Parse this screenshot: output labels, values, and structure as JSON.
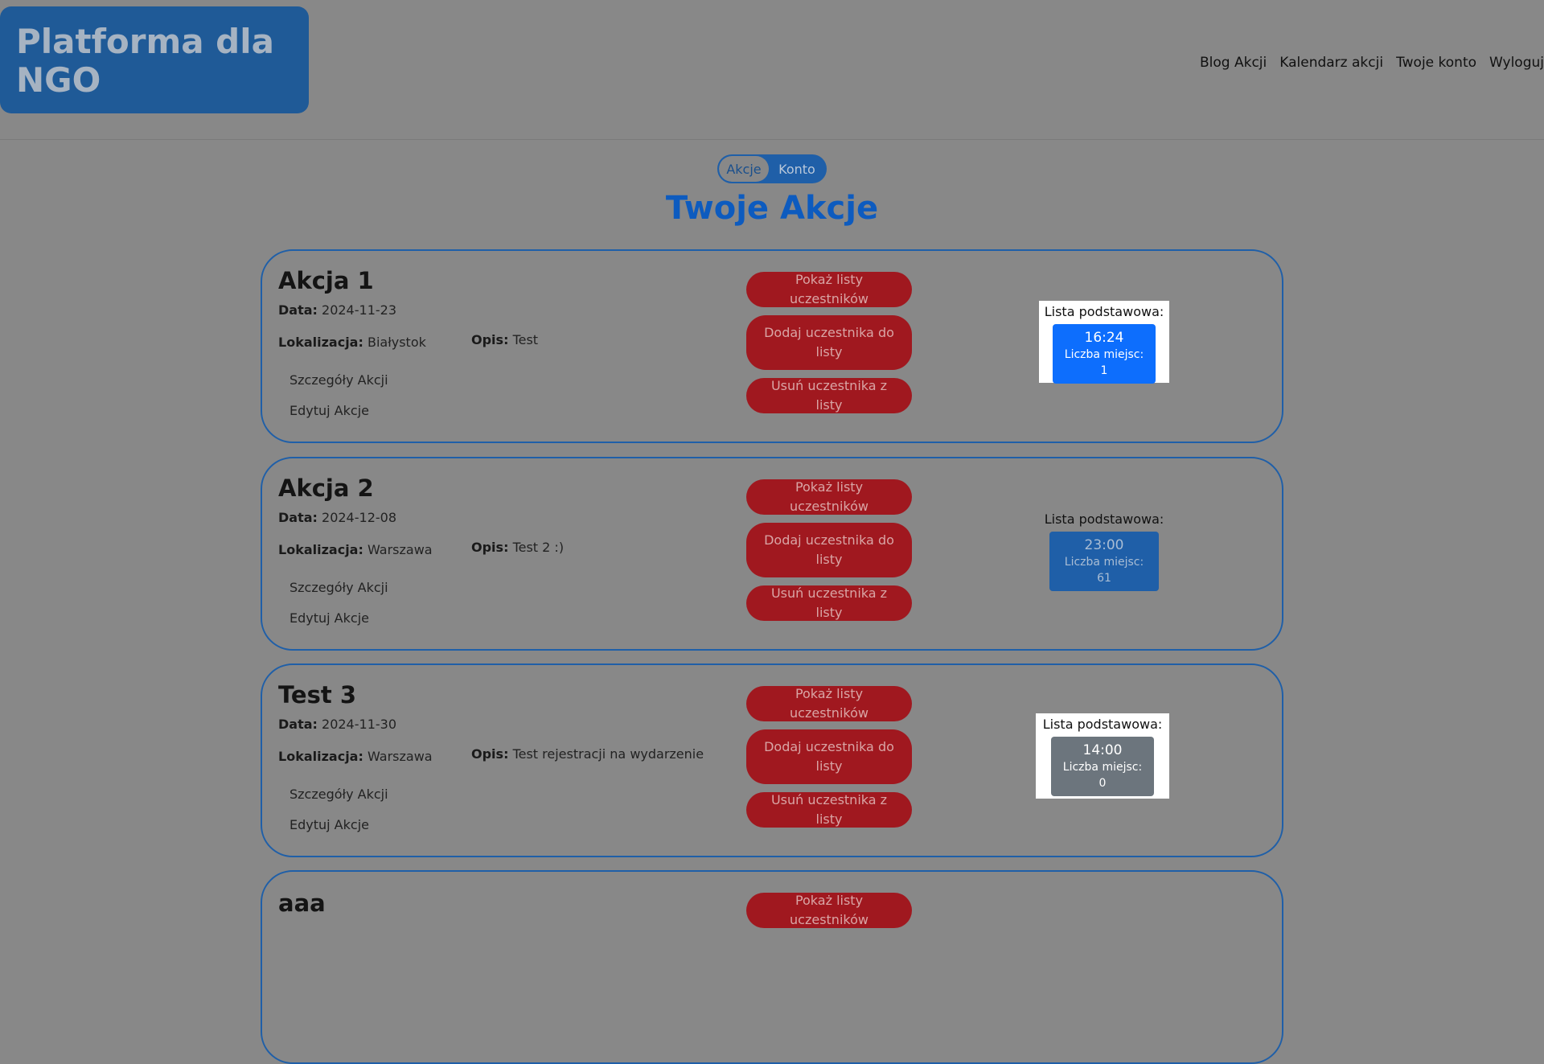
{
  "header": {
    "logo": "Platforma dla NGO",
    "nav": [
      "Blog Akcji",
      "Kalendarz akcji",
      "Twoje konto",
      "Wyloguj"
    ]
  },
  "toggle": {
    "active": "Akcje",
    "inactive": "Konto"
  },
  "page_title": "Twoje Akcje",
  "labels": {
    "date": "Data:",
    "location": "Lokalizacja:",
    "description": "Opis:",
    "details_link": "Szczegóły Akcji",
    "edit_link": "Edytuj Akcje",
    "show_lists_button": "Pokaż listy uczestników",
    "add_participant_button": "Dodaj uczestnika do listy",
    "remove_participant_button": "Usuń uczestnika z listy",
    "list_title": "Lista podstawowa:",
    "seats_prefix": "Liczba miejsc:"
  },
  "actions": [
    {
      "title": "Akcja 1",
      "date": "2024-11-23",
      "location": "Białystok",
      "description": "Test",
      "slot_time": "16:24",
      "seats": "Liczba miejsc: 1",
      "slot_color": "#0d6efd"
    },
    {
      "title": "Akcja 2",
      "date": "2024-12-08",
      "location": "Warszawa",
      "description": "Test 2 :)",
      "slot_time": "23:00",
      "seats": "Liczba miejsc: 61",
      "slot_color": "#1f5fa8"
    },
    {
      "title": "Test 3",
      "date": "2024-11-30",
      "location": "Warszawa",
      "description": "Test rejestracji na wydarzenie",
      "slot_time": "14:00",
      "seats": "Liczba miejsc: 0",
      "slot_color": "#6c757d"
    },
    {
      "title": "aaa"
    }
  ],
  "colors": {
    "background": "#888888",
    "brand_blue": "#1f5a97",
    "title_blue": "#0d5bbf",
    "danger_red": "#a0181f"
  }
}
